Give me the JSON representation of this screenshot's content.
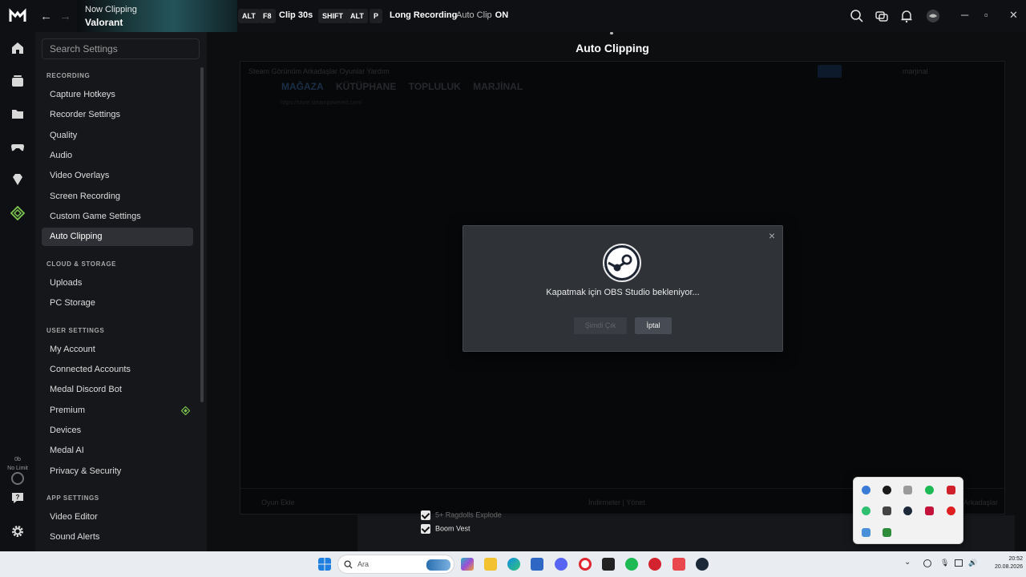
{
  "topbar": {
    "now_clipping": "Now Clipping",
    "game": "Valorant",
    "hotkeys": [
      {
        "keys": [
          "ALT",
          "F8"
        ],
        "label": "Clip 30s"
      },
      {
        "keys": [
          "SHIFT",
          "ALT",
          "P"
        ],
        "label": "Long Recording"
      }
    ],
    "auto_clip_label": "Auto Clip",
    "auto_clip_state": "ON",
    "icons": [
      "search-icon",
      "screens-icon",
      "bell-icon",
      "avatar-icon"
    ],
    "window_controls": [
      "minimize",
      "maximize",
      "close"
    ]
  },
  "rail": {
    "icons": [
      "home-icon",
      "clips-icon",
      "folder-icon",
      "gamepad-icon",
      "gem-icon",
      "medal-premium-icon"
    ],
    "storage_used": "0b",
    "storage_limit": "No Limit",
    "bottom_icons": [
      "help-icon",
      "settings-icon"
    ]
  },
  "sidebar": {
    "search_placeholder": "Search Settings",
    "sections": [
      {
        "title": "RECORDING",
        "items": [
          "Capture Hotkeys",
          "Recorder Settings",
          "Quality",
          "Audio",
          "Video Overlays",
          "Screen Recording",
          "Custom Game Settings",
          "Auto Clipping"
        ]
      },
      {
        "title": "CLOUD & STORAGE",
        "items": [
          "Uploads",
          "PC Storage"
        ]
      },
      {
        "title": "USER SETTINGS",
        "items": [
          "My Account",
          "Connected Accounts",
          "Medal Discord Bot",
          "Premium",
          "Devices",
          "Medal AI",
          "Privacy & Security"
        ]
      },
      {
        "title": "APP SETTINGS",
        "items": [
          "Video Editor",
          "Sound Alerts"
        ]
      }
    ],
    "active_item": "Auto Clipping"
  },
  "main": {
    "page_title": "Auto Clipping"
  },
  "steam_window": {
    "menu": "Steam   Görünüm   Arkadaşlar   Oyunlar   Yardım",
    "tabs": [
      "MAĞAZA",
      "KÜTÜPHANE",
      "TOPLULUK",
      "MARJİNAL"
    ],
    "url": "https://store.steampowered.com/",
    "user": "marjinal",
    "footer_left": "Oyun Ekle",
    "footer_center": "İndirmeler | Yönet",
    "footer_right": "Arkadaşlar"
  },
  "dialog": {
    "message": "Kapatmak için OBS Studio bekleniyor...",
    "btn_disabled": "Şimdi Çık",
    "btn_primary": "İptal",
    "close_glyph": "×"
  },
  "below_list": {
    "items": [
      "5+ Ragdolls Explode",
      "Boom Vest"
    ]
  },
  "tray": {
    "icon_colors": [
      "#3b7bd8",
      "#d03a3a",
      "#888888",
      "#1db954",
      "#d0202b",
      "#2fbf71",
      "#444444",
      "#1b2838",
      "#c4133a",
      "#e02020",
      "#4a90d9",
      "#2e8b3a"
    ]
  },
  "taskbar": {
    "search_text": "Ara",
    "clock_time": "20:52",
    "clock_date": "20.08.2026",
    "apps": [
      "windows-icon",
      "search",
      "copilot-icon",
      "explorer-icon",
      "edge-icon",
      "store-icon",
      "discord-icon",
      "opera-icon",
      "medal-icon",
      "spotify-icon",
      "app-red-icon",
      "valorant-icon",
      "steam-icon"
    ]
  },
  "colors": {
    "accent": "#2e3035",
    "premium_green": "#7ec850",
    "dialog_bg": "#2f3237"
  }
}
